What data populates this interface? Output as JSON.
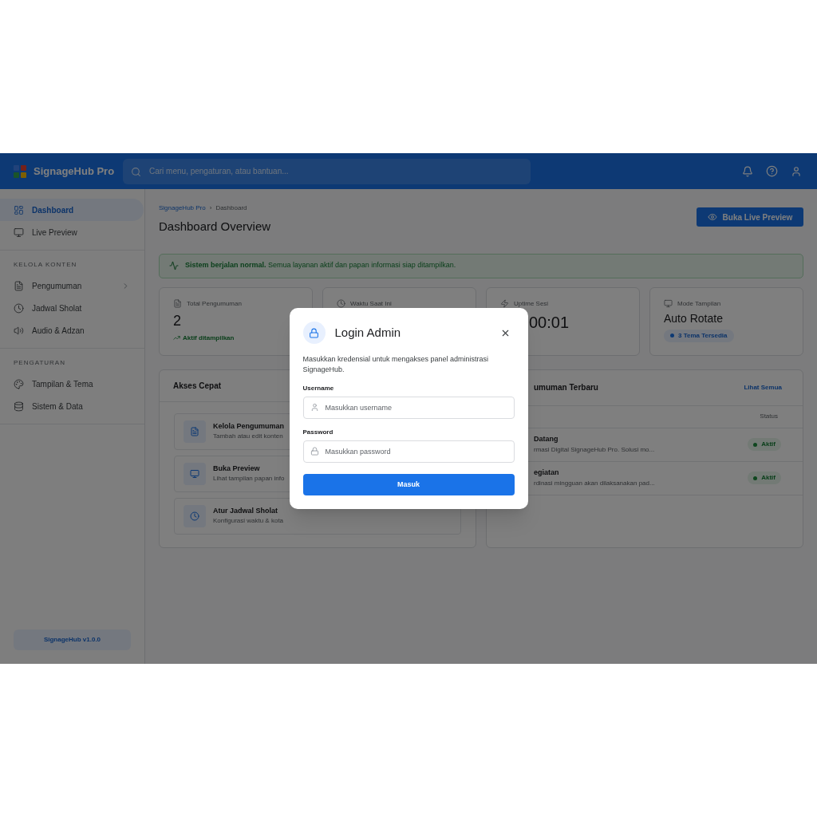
{
  "header": {
    "brand": "SignageHub Pro",
    "search": {
      "placeholder": "Cari menu, pengaturan, atau bantuan..."
    }
  },
  "sidebar": {
    "groups": [
      {
        "items": [
          {
            "label": "Dashboard",
            "kind": "link",
            "selected": true
          },
          {
            "label": "Live Preview",
            "kind": "link",
            "selected": false
          }
        ]
      },
      {
        "title": "KELOLA KONTEN",
        "items": [
          {
            "label": "Pengumuman",
            "kind": "submenu",
            "selected": false
          },
          {
            "label": "Jadwal Sholat",
            "kind": "link",
            "selected": false
          },
          {
            "label": "Audio & Adzan",
            "kind": "link",
            "selected": false
          }
        ]
      },
      {
        "title": "PENGATURAN",
        "items": [
          {
            "label": "Tampilan & Tema",
            "kind": "link",
            "selected": false
          },
          {
            "label": "Sistem & Data",
            "kind": "link",
            "selected": false
          }
        ]
      }
    ],
    "version": "SignageHub v1.0.0"
  },
  "page": {
    "breadcrumb": [
      "SignageHub Pro",
      "Dashboard"
    ],
    "breadcrumb_separator": "›",
    "title": "Dashboard Overview",
    "primary_button": "Buka Live Preview",
    "alert": "**Sistem berjalan normal.** Semua layanan aktif dan papan informasi siap ditampilkan.",
    "stats": [
      {
        "label": "Total Pengumuman",
        "value": "2",
        "kind": "trend",
        "note": "Aktif ditampilkan"
      },
      {
        "label": "Waktu Saat Ini",
        "kind": "plain"
      },
      {
        "label": "Uptime Sesi",
        "value": "00:01",
        "kind": "plain"
      },
      {
        "label": "Mode Tampilan",
        "value": "Auto Rotate",
        "kind": "badge",
        "note": "3 Tema Tersedia"
      }
    ],
    "quick_access": {
      "title": "Akses Cepat",
      "items": [
        {
          "title": "Kelola Pengumuman",
          "description": "Tambah atau edit konten"
        },
        {
          "title": "Buka Preview",
          "description": "Lihat tampilan papan info"
        },
        {
          "title": "Atur Jadwal Sholat",
          "description": "Konfigurasi waktu & kota"
        }
      ]
    },
    "announcements": {
      "title": "umuman Terbaru",
      "link": "Lihat Semua",
      "columns": [
        "Status"
      ],
      "rows": [
        {
          "title": "Datang",
          "summary": "rmasi Digital SignageHub Pro. Solusi mo...",
          "status": "Aktif"
        },
        {
          "title": "egiatan",
          "summary": "rdinasi mingguan akan dilaksanakan pad...",
          "status": "Aktif"
        }
      ]
    }
  },
  "dialog": {
    "title": "Login Admin",
    "description": "Masukkan kredensial untuk mengakses panel administrasi SignageHub.",
    "fields": [
      {
        "label": "Username",
        "placeholder": "Masukkan username",
        "kind": "text"
      },
      {
        "label": "Password",
        "placeholder": "Masukkan password",
        "kind": "password"
      }
    ],
    "submit": "Masuk"
  }
}
